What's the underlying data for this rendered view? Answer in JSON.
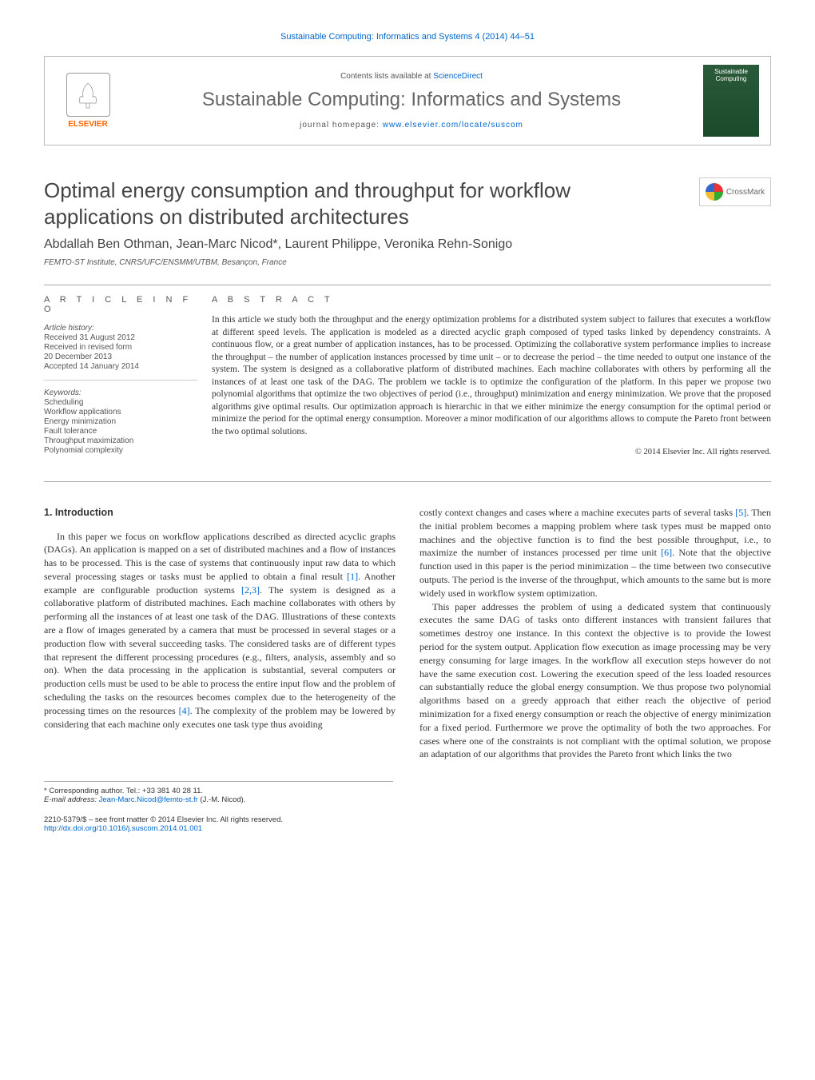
{
  "header_citation": "Sustainable Computing: Informatics and Systems 4 (2014) 44–51",
  "journal_box": {
    "publisher": "ELSEVIER",
    "contents_prefix": "Contents lists available at ",
    "contents_link": "ScienceDirect",
    "journal_name": "Sustainable Computing: Informatics and Systems",
    "homepage_prefix": "journal homepage: ",
    "homepage_link": "www.elsevier.com/locate/suscom",
    "cover_text": "Sustainable Computing"
  },
  "crossmark": "CrossMark",
  "title": "Optimal energy consumption and throughput for workflow applications on distributed architectures",
  "authors": "Abdallah Ben Othman, Jean-Marc Nicod*, Laurent Philippe, Veronika Rehn-Sonigo",
  "affiliation": "FEMTO-ST Institute, CNRS/UFC/ENSMM/UTBM, Besançon, France",
  "article_info": {
    "heading": "A R T I C L E   I N F O",
    "history_label": "Article history:",
    "history": [
      "Received 31 August 2012",
      "Received in revised form",
      "20 December 2013",
      "Accepted 14 January 2014"
    ],
    "keywords_label": "Keywords:",
    "keywords": [
      "Scheduling",
      "Workflow applications",
      "Energy minimization",
      "Fault tolerance",
      "Throughput maximization",
      "Polynomial complexity"
    ]
  },
  "abstract": {
    "heading": "A B S T R A C T",
    "text": "In this article we study both the throughput and the energy optimization problems for a distributed system subject to failures that executes a workflow at different speed levels. The application is modeled as a directed acyclic graph composed of typed tasks linked by dependency constraints. A continuous flow, or a great number of application instances, has to be processed. Optimizing the collaborative system performance implies to increase the throughput – the number of application instances processed by time unit – or to decrease the period – the time needed to output one instance of the system. The system is designed as a collaborative platform of distributed machines. Each machine collaborates with others by performing all the instances of at least one task of the DAG. The problem we tackle is to optimize the configuration of the platform. In this paper we propose two polynomial algorithms that optimize the two objectives of period (i.e., throughput) minimization and energy minimization. We prove that the proposed algorithms give optimal results. Our optimization approach is hierarchic in that we either minimize the energy consumption for the optimal period or minimize the period for the optimal energy consumption. Moreover a minor modification of our algorithms allows to compute the Pareto front between the two optimal solutions.",
    "copyright": "© 2014 Elsevier Inc. All rights reserved."
  },
  "intro_heading": "1. Introduction",
  "col1_p1": "In this paper we focus on workflow applications described as directed acyclic graphs (DAGs). An application is mapped on a set of distributed machines and a flow of instances has to be processed. This is the case of systems that continuously input raw data to which several processing stages or tasks must be applied to obtain a final result [1]. Another example are configurable production systems [2,3]. The system is designed as a collaborative platform of distributed machines. Each machine collaborates with others by performing all the instances of at least one task of the DAG. Illustrations of these contexts are a flow of images generated by a camera that must be processed in several stages or a production flow with several succeeding tasks. The considered tasks are of different types that represent the different processing procedures (e.g., filters, analysis, assembly and so on). When the data processing in the application is substantial, several computers or production cells must be used to be able to process the entire input flow and the problem of scheduling the tasks on the resources becomes complex due to the heterogeneity of the processing times on the resources [4]. The complexity of the problem may be lowered by considering that each machine only executes one task type thus avoiding",
  "col2_p1": "costly context changes and cases where a machine executes parts of several tasks [5]. Then the initial problem becomes a mapping problem where task types must be mapped onto machines and the objective function is to find the best possible throughput, i.e., to maximize the number of instances processed per time unit [6]. Note that the objective function used in this paper is the period minimization – the time between two consecutive outputs. The period is the inverse of the throughput, which amounts to the same but is more widely used in workflow system optimization.",
  "col2_p2": "This paper addresses the problem of using a dedicated system that continuously executes the same DAG of tasks onto different instances with transient failures that sometimes destroy one instance. In this context the objective is to provide the lowest period for the system output. Application flow execution as image processing may be very energy consuming for large images. In the workflow all execution steps however do not have the same execution cost. Lowering the execution speed of the less loaded resources can substantially reduce the global energy consumption. We thus propose two polynomial algorithms based on a greedy approach that either reach the objective of period minimization for a fixed energy consumption or reach the objective of energy minimization for a fixed period. Furthermore we prove the optimality of both the two approaches. For cases where one of the constraints is not compliant with the optimal solution, we propose an adaptation of our algorithms that provides the Pareto front which links the two",
  "footer": {
    "corresp_label": "* Corresponding author. Tel.: +33 381 40 28 11.",
    "email_label": "E-mail address: ",
    "email": "Jean-Marc.Nicod@femto-st.fr",
    "email_suffix": " (J.-M. Nicod).",
    "issn_line": "2210-5379/$ – see front matter © 2014 Elsevier Inc. All rights reserved.",
    "doi": "http://dx.doi.org/10.1016/j.suscom.2014.01.001"
  }
}
